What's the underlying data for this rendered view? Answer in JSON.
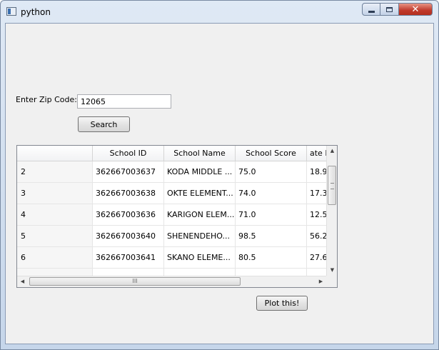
{
  "window": {
    "title": "python",
    "close_glyph": "✕"
  },
  "form": {
    "zip_label": "Enter Zip Code:",
    "zip_value": "12065",
    "search_label": "Search",
    "plot_label": "Plot this!"
  },
  "table": {
    "headers": [
      "",
      "School ID",
      "School Name",
      "School Score",
      "ate I"
    ],
    "rows": [
      [
        "2",
        "362667003637",
        "KODA MIDDLE ...",
        "75.0",
        "18.9"
      ],
      [
        "3",
        "362667003638",
        "OKTE ELEMENT...",
        "74.0",
        "17.3"
      ],
      [
        "4",
        "362667003636",
        "KARIGON ELEM...",
        "71.0",
        "12.5"
      ],
      [
        "5",
        "362667003640",
        "SHENENDEHO...",
        "98.5",
        "56.2"
      ],
      [
        "6",
        "362667003641",
        "SKANO ELEME...",
        "80.5",
        "27.6"
      ]
    ],
    "scroll": {
      "up": "▲",
      "down": "▼",
      "left": "◀",
      "right": "▶",
      "grip": "III"
    }
  }
}
